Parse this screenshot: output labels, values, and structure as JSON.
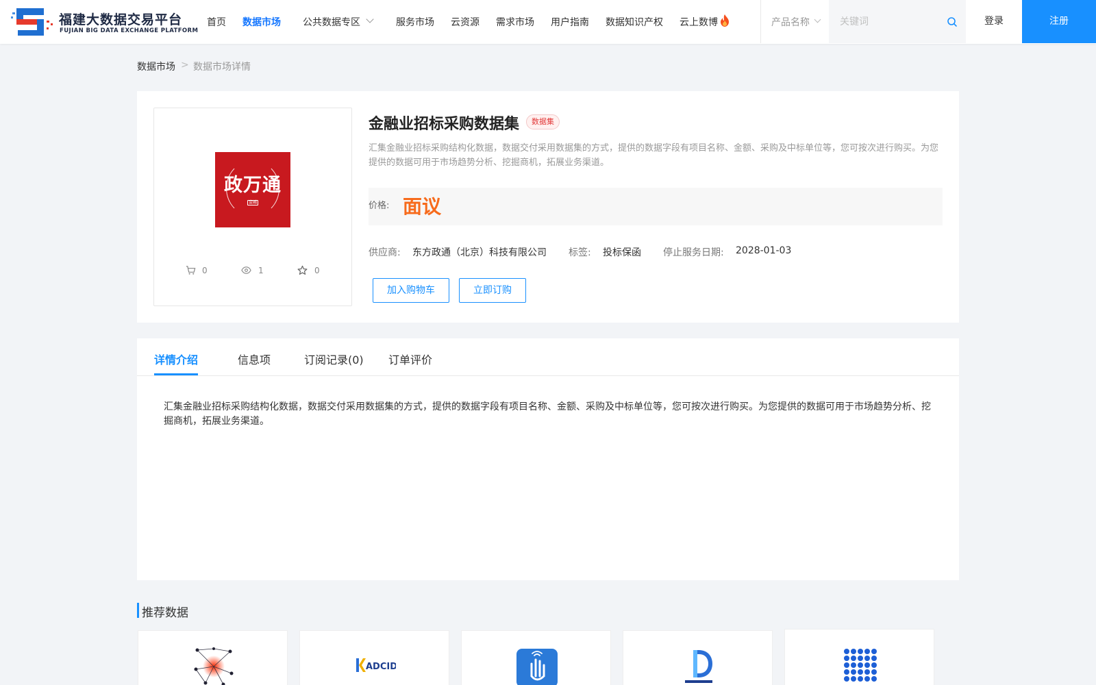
{
  "header": {
    "logo_cn": "福建大数据交易平台",
    "logo_en": "FUJIAN BIG DATA EXCHANGE  PLATFORM",
    "nav": [
      {
        "label": "首页"
      },
      {
        "label": "数据市场"
      },
      {
        "label": "公共数据专区"
      },
      {
        "label": "服务市场"
      },
      {
        "label": "云资源"
      },
      {
        "label": "需求市场"
      },
      {
        "label": "用户指南"
      },
      {
        "label": "数据知识产权"
      },
      {
        "label": "云上数博"
      }
    ],
    "product_select": "产品名称",
    "search_placeholder": "关键词",
    "login": "登录",
    "register": "注册"
  },
  "breadcrumb": {
    "root": "数据市场",
    "separator": ">",
    "current": "数据市场详情"
  },
  "product": {
    "title": "金融业招标采购数据集",
    "badge": "数据集",
    "logo_text": "政万通",
    "logo_subtext": "金融",
    "description": "汇集金融业招标采购结构化数据，数据交付采用数据集的方式，提供的数据字段有项目名称、金额、采购及中标单位等，您可按次进行购买。为您提供的数据可用于市场趋势分析、挖掘商机，拓展业务渠道。",
    "price_label": "价格:",
    "price_value": "面议",
    "supplier_label": "供应商:",
    "supplier_value": "东方政通（北京）科技有限公司",
    "tag_label": "标签:",
    "tag_value": "投标保函",
    "stop_label": "停止服务日期:",
    "stop_value": "2028-01-03",
    "stats": {
      "cart": "0",
      "views": "1",
      "favorites": "0"
    },
    "add_cart": "加入购物车",
    "subscribe": "立即订购"
  },
  "tabs": {
    "items": [
      {
        "label": "详情介绍"
      },
      {
        "label": "信息项"
      },
      {
        "label": "订阅记录(0)"
      },
      {
        "label": "订单评价"
      }
    ],
    "content": "汇集金融业招标采购结构化数据，数据交付采用数据集的方式，提供的数据字段有项目名称、金额、采购及中标单位等，您可按次进行购买。为您提供的数据可用于市场趋势分析、挖掘商机，拓展业务渠道。"
  },
  "recommended": {
    "title": "推荐数据",
    "cards": [
      {
        "icon": "network-graph-icon"
      },
      {
        "icon": "adcid-logo-icon",
        "text": "ADCID"
      },
      {
        "icon": "hand-app-icon"
      },
      {
        "icon": "d-logo-icon"
      },
      {
        "icon": "dot-grid-icon"
      }
    ]
  },
  "colors": {
    "primary": "#1890ff",
    "price": "#f76b1c",
    "badge_red": "#e23a3a",
    "logo_red": "#c8191f"
  }
}
